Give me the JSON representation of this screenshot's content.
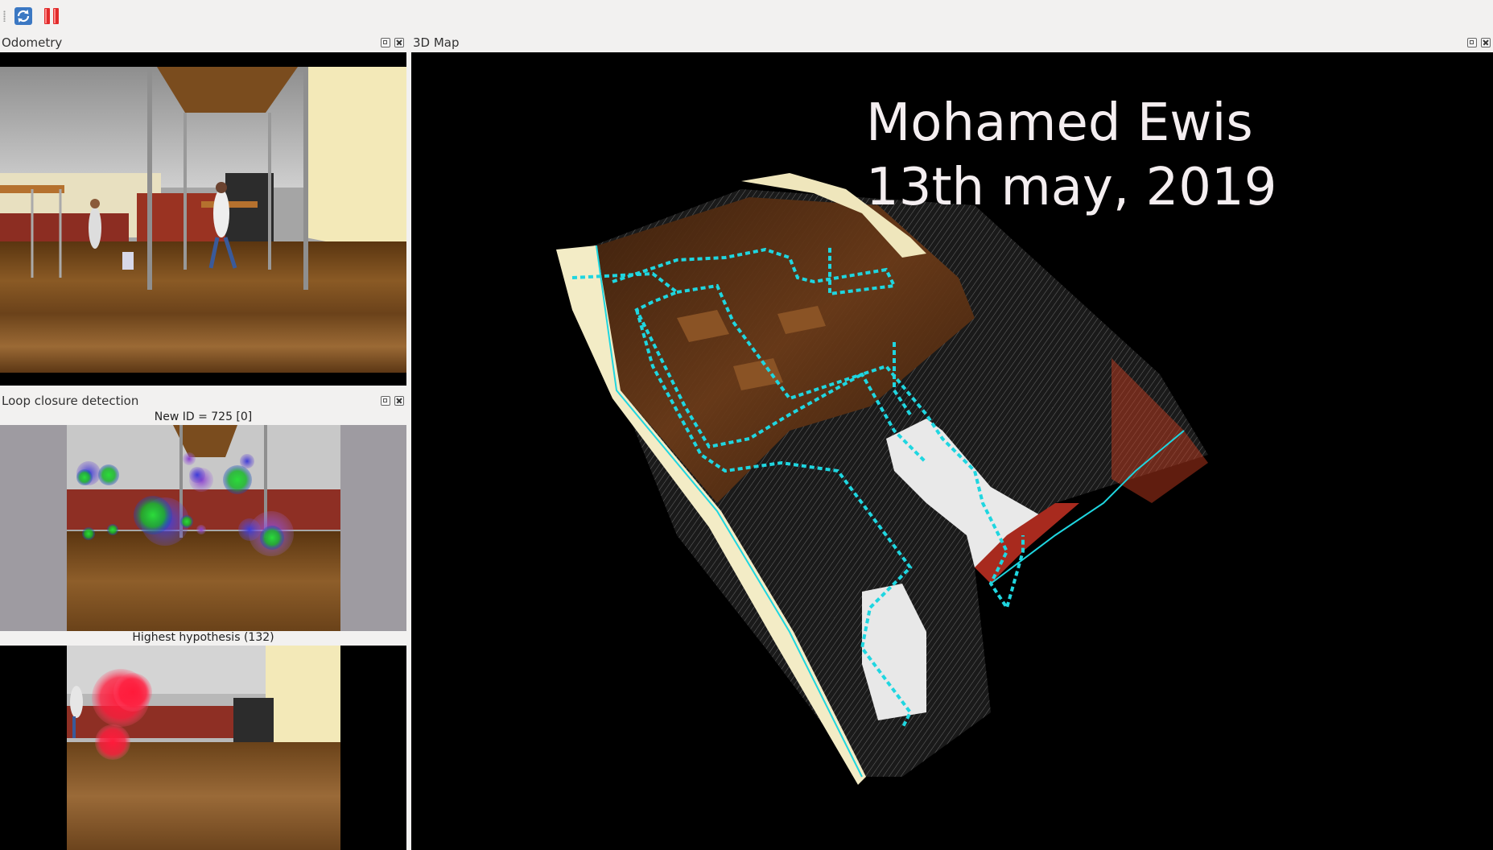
{
  "toolbar": {
    "buttons": [
      {
        "name": "refresh",
        "icon": "refresh-icon"
      },
      {
        "name": "pause",
        "icon": "pause-icon"
      }
    ]
  },
  "odometry": {
    "title": "Odometry"
  },
  "loop_closure": {
    "title": "Loop closure detection",
    "new_id_label": "New ID = 725 [0]",
    "hypothesis_label": "Highest hypothesis (132)"
  },
  "map3d": {
    "title": "3D Map",
    "overlay_line1": "Mohamed Ewis",
    "overlay_line2": "13th may, 2019"
  },
  "colors": {
    "trajectory": "#1fd6e0",
    "feature_green": "#22cc33",
    "feature_red": "#ff1a3a",
    "background_dark": "#000000"
  }
}
